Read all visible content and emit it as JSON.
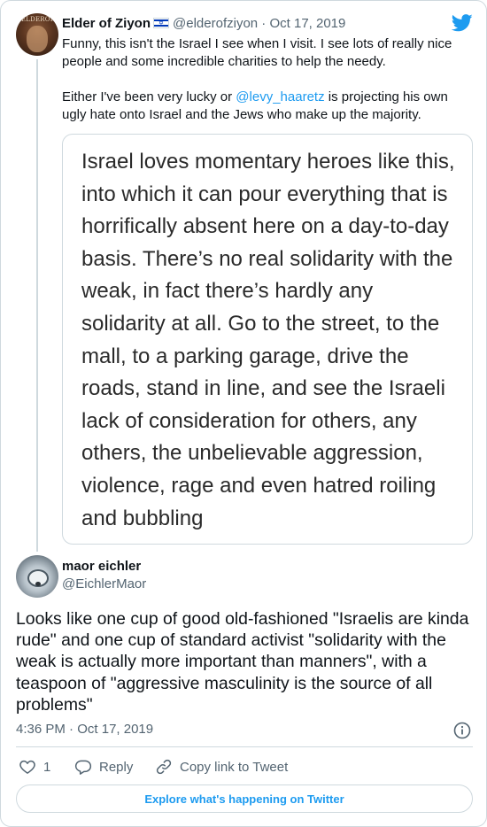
{
  "parent_tweet": {
    "author_name": "Elder of Ziyon",
    "author_handle": "@elderofziyon",
    "date": "Oct 17, 2019",
    "separator": "·",
    "text_part1": "Funny, this isn't the Israel I see when I visit. I see lots of really nice people and some incredible charities to help the needy.",
    "text_part2_before": "Either I've been very lucky or ",
    "mention": "@levy_haaretz",
    "text_part2_after": " is projecting his own ugly hate onto Israel and the Jews who make up the majority.",
    "quoted_image_text": "Israel loves momentary heroes like this, into which it can pour everything that is horrifically absent here on a day-to-day basis. There’s no real solidarity with the weak, in fact there’s hardly any solidarity at all. Go to the street, to the mall, to a parking garage, drive the roads, stand in line, and see the Israeli lack of consideration for others, any others, the unbelievable aggression, violence, rage and even hatred roiling and bubbling",
    "avatar_text": "ELDEROF"
  },
  "main_tweet": {
    "author_name": "maor eichler",
    "author_handle": "@EichlerMaor",
    "text": "Looks like one cup of good old-fashioned \"Israelis are kinda rude\" and one cup of standard activist \"solidarity with the weak is actually more important than manners\", with a teaspoon of \"aggressive masculinity is the source of all problems\"",
    "time": "4:36 PM",
    "separator": "·",
    "date": "Oct 17, 2019"
  },
  "actions": {
    "like_count": "1",
    "reply_label": "Reply",
    "copy_link_label": "Copy link to Tweet"
  },
  "footer": {
    "explore_label": "Explore what's happening on Twitter"
  },
  "colors": {
    "accent": "#1d9bf0",
    "text_primary": "#0f1419",
    "text_secondary": "#536471",
    "border": "#cfd9de"
  },
  "icons": [
    "twitter-logo-icon",
    "israel-flag-icon",
    "heart-icon",
    "reply-icon",
    "link-icon",
    "info-icon"
  ]
}
